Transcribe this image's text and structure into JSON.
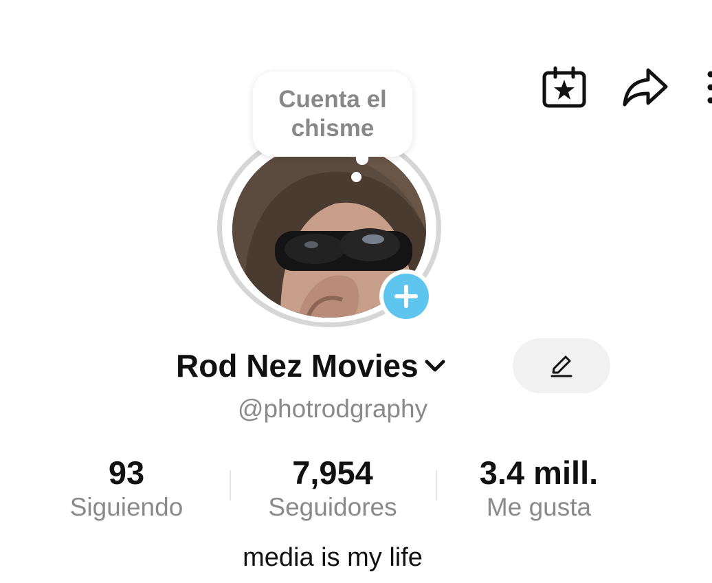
{
  "header": {
    "icons": [
      "calendar-star-icon",
      "share-icon",
      "more-icon"
    ]
  },
  "status_bubble": {
    "text": "Cuenta el chisme"
  },
  "profile": {
    "display_name": "Rod Nez Movies",
    "username": "@photrodgraphy",
    "bio": "media is my life"
  },
  "stats": {
    "following": {
      "value": "93",
      "label": "Siguiendo"
    },
    "followers": {
      "value": "7,954",
      "label": "Seguidores"
    },
    "likes": {
      "value": "3.4 mill.",
      "label": "Me gusta"
    }
  },
  "colors": {
    "accent_add": "#5ec6ee",
    "ring": "#d6d6d6",
    "secondary_text": "#8a8a8a",
    "edit_button_bg": "#f1f1f2"
  }
}
